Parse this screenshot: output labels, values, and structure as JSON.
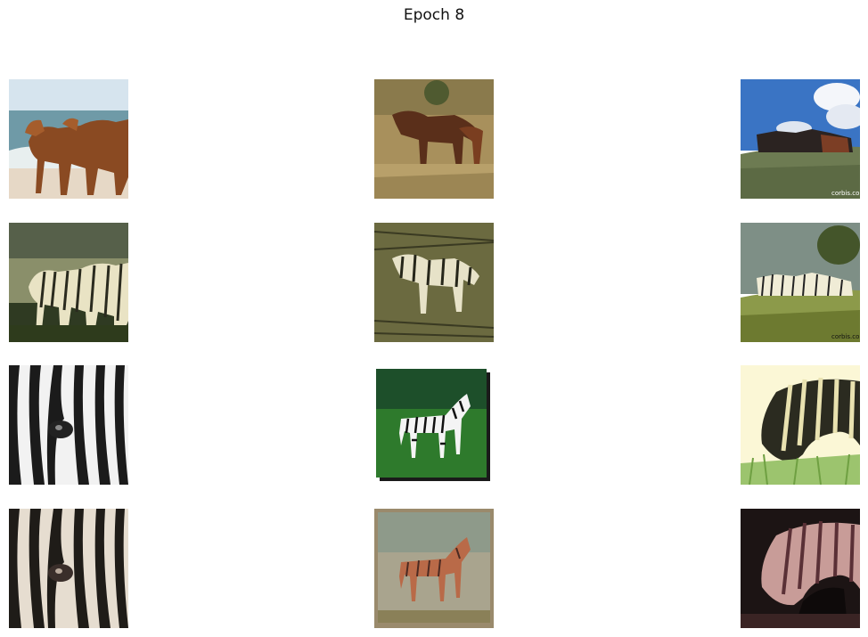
{
  "figure": {
    "title": "Epoch 8",
    "watermark": "corbis.com"
  },
  "grid": {
    "rows": [
      {
        "role": "real horse photos",
        "tiles": [
          "horses-on-beach",
          "horses-in-grass",
          "horse-herd-on-hill"
        ]
      },
      {
        "role": "generated zebra translations",
        "tiles": [
          "beach-horses-as-zebras",
          "grass-horses-as-zebras",
          "hill-herd-as-zebras"
        ]
      },
      {
        "role": "real zebra photos",
        "tiles": [
          "zebra-stripe-closeup",
          "zebra-foal-on-grass",
          "zebra-grazing"
        ]
      },
      {
        "role": "generated horse translations",
        "tiles": [
          "stripe-closeup-reconstructed",
          "foal-reconstructed",
          "grazing-reconstructed"
        ]
      }
    ]
  }
}
